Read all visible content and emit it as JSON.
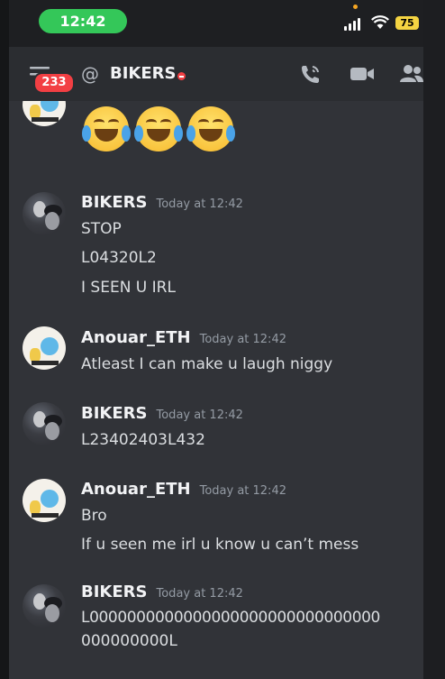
{
  "status_bar": {
    "time": "12:42",
    "battery": "75"
  },
  "header": {
    "badge": "233",
    "channel": "BIKERS"
  },
  "emoji_reaction": "😂😂😂",
  "messages": [
    {
      "author": "BIKERS",
      "time": "Today at 12:42",
      "lines": [
        "STOP",
        "L04320L2",
        "I SEEN U IRL"
      ]
    },
    {
      "author": "Anouar_ETH",
      "time": "Today at 12:42",
      "lines": [
        "Atleast I can make u laugh niggy"
      ]
    },
    {
      "author": "BIKERS",
      "time": "Today at 12:42",
      "lines": [
        "L23402403L432"
      ]
    },
    {
      "author": "Anouar_ETH",
      "time": "Today at 12:42",
      "lines": [
        "Bro",
        "If u seen me irl u know u can’t mess"
      ]
    },
    {
      "author": "BIKERS",
      "time": "Today at 12:42",
      "lines": [
        "L0000000000000000000000000000000",
        "000000000L"
      ]
    }
  ],
  "colors": {
    "background": "#313338",
    "header": "#2b2d31",
    "badge": "#f23f43",
    "time_pill": "#34c759",
    "battery": "#f5d442"
  },
  "icons": [
    "menu-icon",
    "at-icon",
    "dnd-status-icon",
    "call-icon",
    "video-icon",
    "members-icon"
  ]
}
